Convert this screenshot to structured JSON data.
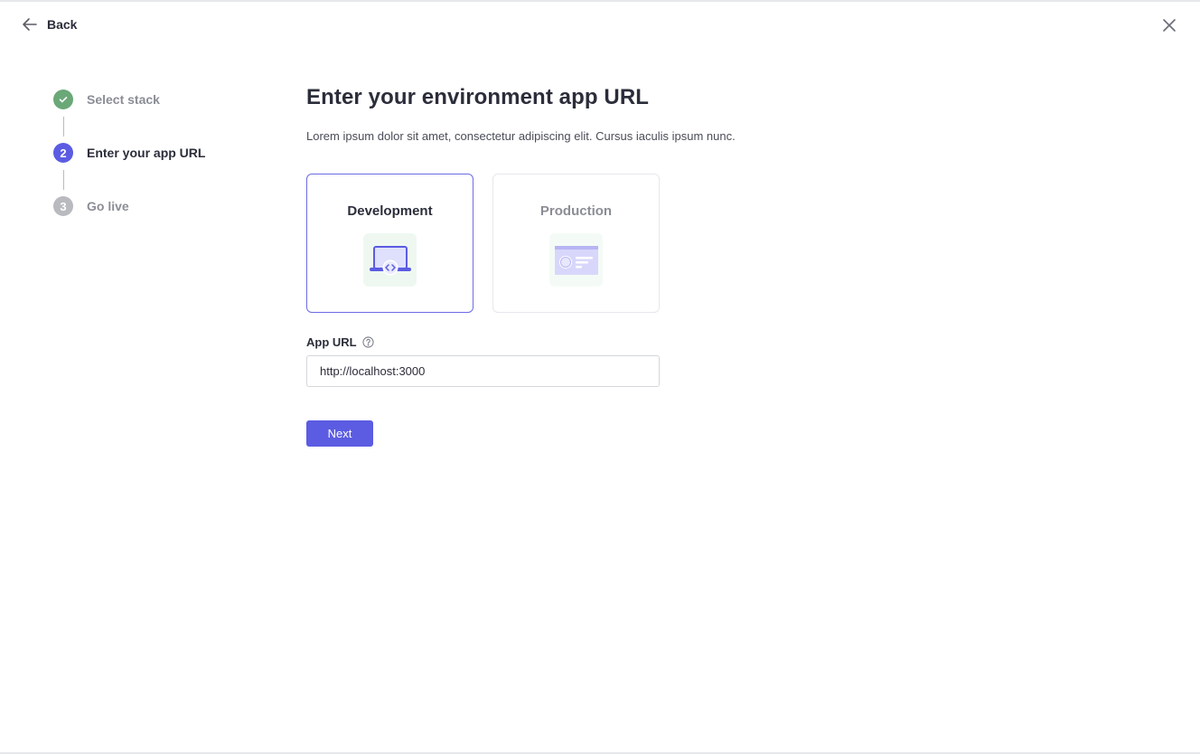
{
  "header": {
    "back_label": "Back"
  },
  "stepper": {
    "steps": [
      {
        "number": "",
        "label": "Select stack",
        "state": "done"
      },
      {
        "number": "2",
        "label": "Enter your app URL",
        "state": "active"
      },
      {
        "number": "3",
        "label": "Go live",
        "state": "todo"
      }
    ]
  },
  "main": {
    "title": "Enter your environment app URL",
    "description": "Lorem ipsum dolor sit amet, consectetur adipiscing elit. Cursus iaculis ipsum nunc.",
    "environments": [
      {
        "label": "Development",
        "selected": true,
        "icon": "laptop-code-icon"
      },
      {
        "label": "Production",
        "selected": false,
        "icon": "browser-window-icon"
      }
    ],
    "url_field": {
      "label": "App URL",
      "value": "http://localhost:3000"
    },
    "next_label": "Next"
  },
  "colors": {
    "accent": "#5b5ce2",
    "done": "#6aa878",
    "todo": "#b9babf",
    "icon_bg": "#eef8f1"
  }
}
